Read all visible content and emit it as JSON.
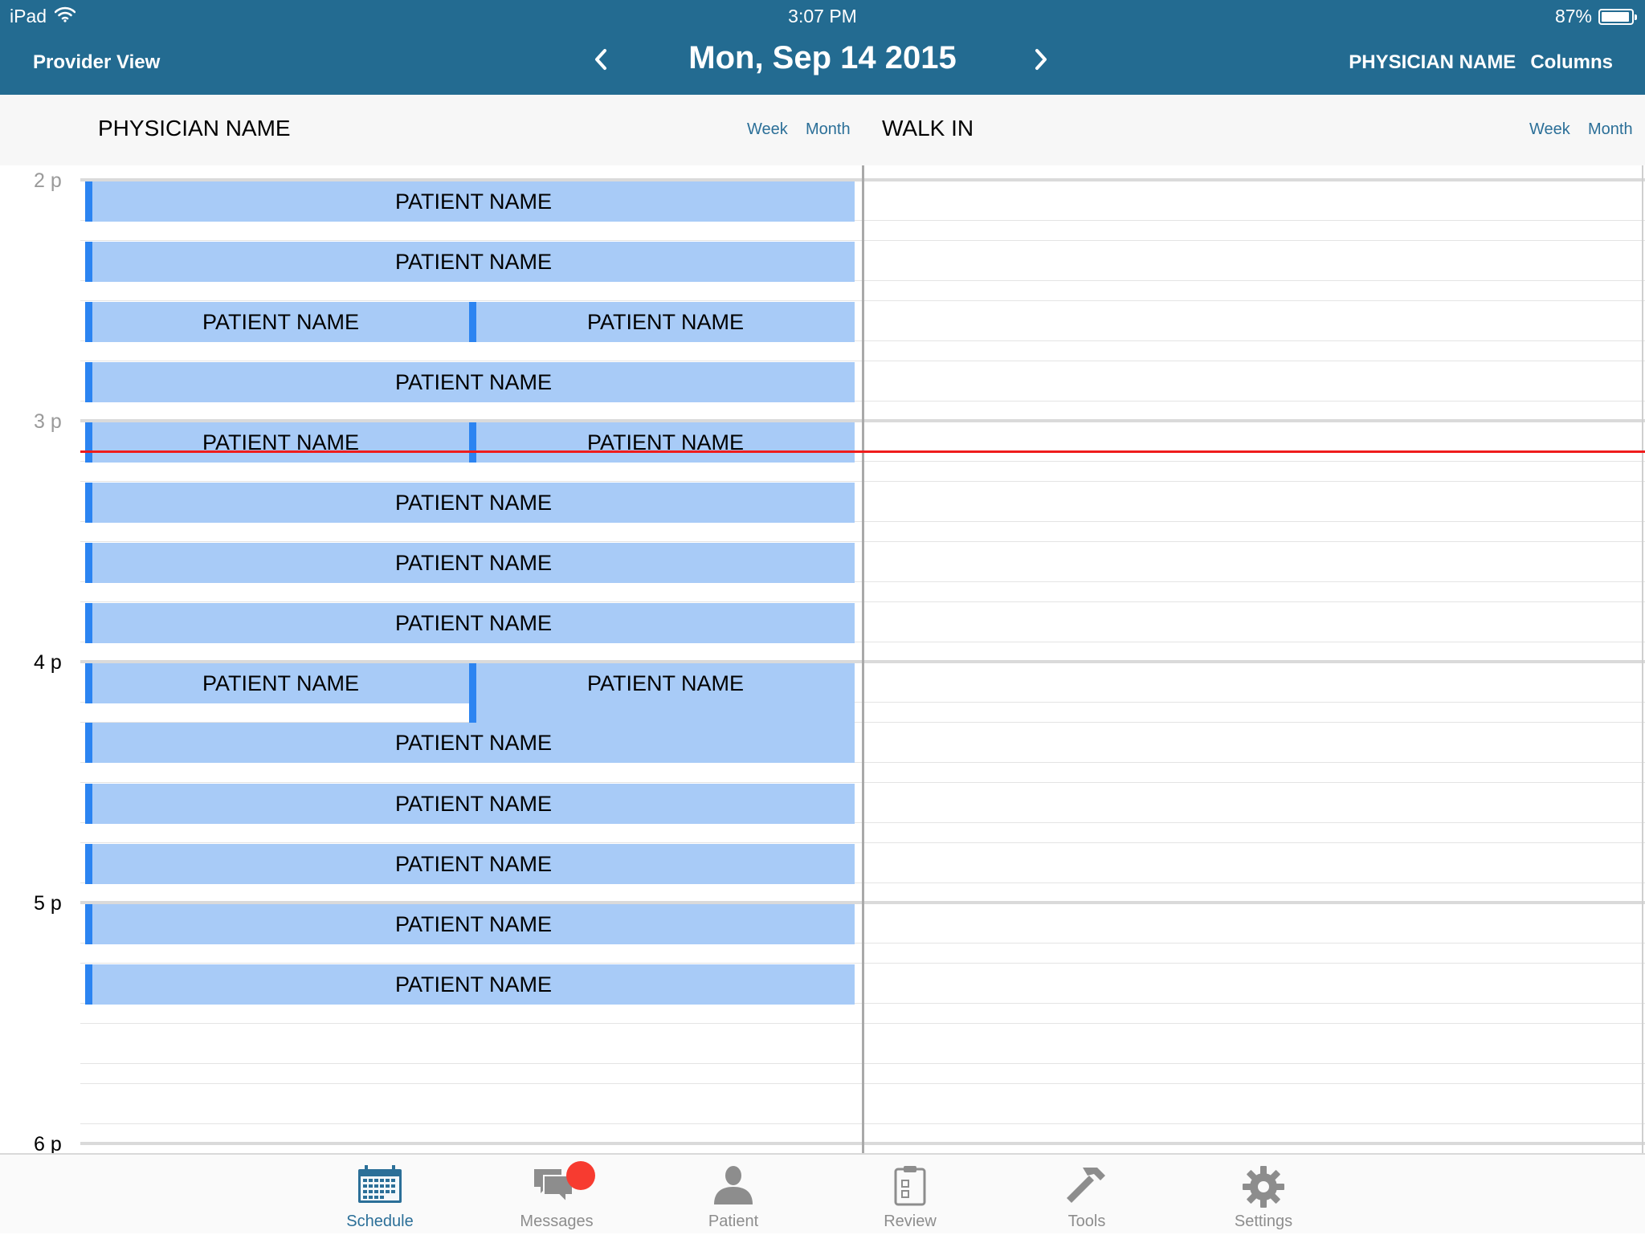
{
  "status_bar": {
    "device": "iPad",
    "time": "3:07 PM",
    "battery": "87%",
    "battery_level": 0.87
  },
  "nav": {
    "left_label": "Provider View",
    "date": "Mon, Sep 14 2015",
    "physician": "PHYSICIAN NAME",
    "columns_label": "Columns",
    "prev_icon": "chevron-left-icon",
    "next_icon": "chevron-right-icon"
  },
  "columns": [
    {
      "title": "PHYSICIAN NAME",
      "week_label": "Week",
      "month_label": "Month"
    },
    {
      "title": "WALK IN",
      "week_label": "Week",
      "month_label": "Month"
    }
  ],
  "hours": [
    "2 p",
    "3 p",
    "4 p",
    "5 p",
    "6 p"
  ],
  "current_time": "3:07 PM",
  "appointments": [
    {
      "slot": 0,
      "patient": "PATIENT NAME"
    },
    {
      "slot": 1,
      "patient": "PATIENT NAME"
    },
    {
      "slot": 2,
      "patient": "PATIENT NAME"
    },
    {
      "slot": 2,
      "patient": "PATIENT NAME"
    },
    {
      "slot": 3,
      "patient": "PATIENT NAME"
    },
    {
      "slot": 4,
      "patient": "PATIENT NAME"
    },
    {
      "slot": 4,
      "patient": "PATIENT NAME"
    },
    {
      "slot": 5,
      "patient": "PATIENT NAME"
    },
    {
      "slot": 6,
      "patient": "PATIENT NAME"
    },
    {
      "slot": 7,
      "patient": "PATIENT NAME"
    },
    {
      "slot": 8,
      "patient": "PATIENT NAME"
    },
    {
      "slot": 8,
      "patient": "PATIENT NAME"
    },
    {
      "slot": 9,
      "patient": "PATIENT NAME"
    },
    {
      "slot": 10,
      "patient": "PATIENT NAME"
    },
    {
      "slot": 11,
      "patient": "PATIENT NAME"
    },
    {
      "slot": 12,
      "patient": "PATIENT NAME"
    },
    {
      "slot": 13,
      "patient": "PATIENT NAME"
    }
  ],
  "tabs": [
    {
      "label": "Schedule",
      "icon": "calendar-icon",
      "active": true
    },
    {
      "label": "Messages",
      "icon": "chat-bubbles-icon",
      "badge": true
    },
    {
      "label": "Patient",
      "icon": "person-icon"
    },
    {
      "label": "Review",
      "icon": "clipboard-icon"
    },
    {
      "label": "Tools",
      "icon": "hammer-icon"
    },
    {
      "label": "Settings",
      "icon": "gear-icon"
    }
  ],
  "colors": {
    "header_bg": "#236b91",
    "appointment_fill": "#a8cbf7",
    "appointment_accent": "#2c84f1",
    "now_line": "#ef1c1c",
    "link": "#2b6f98"
  }
}
